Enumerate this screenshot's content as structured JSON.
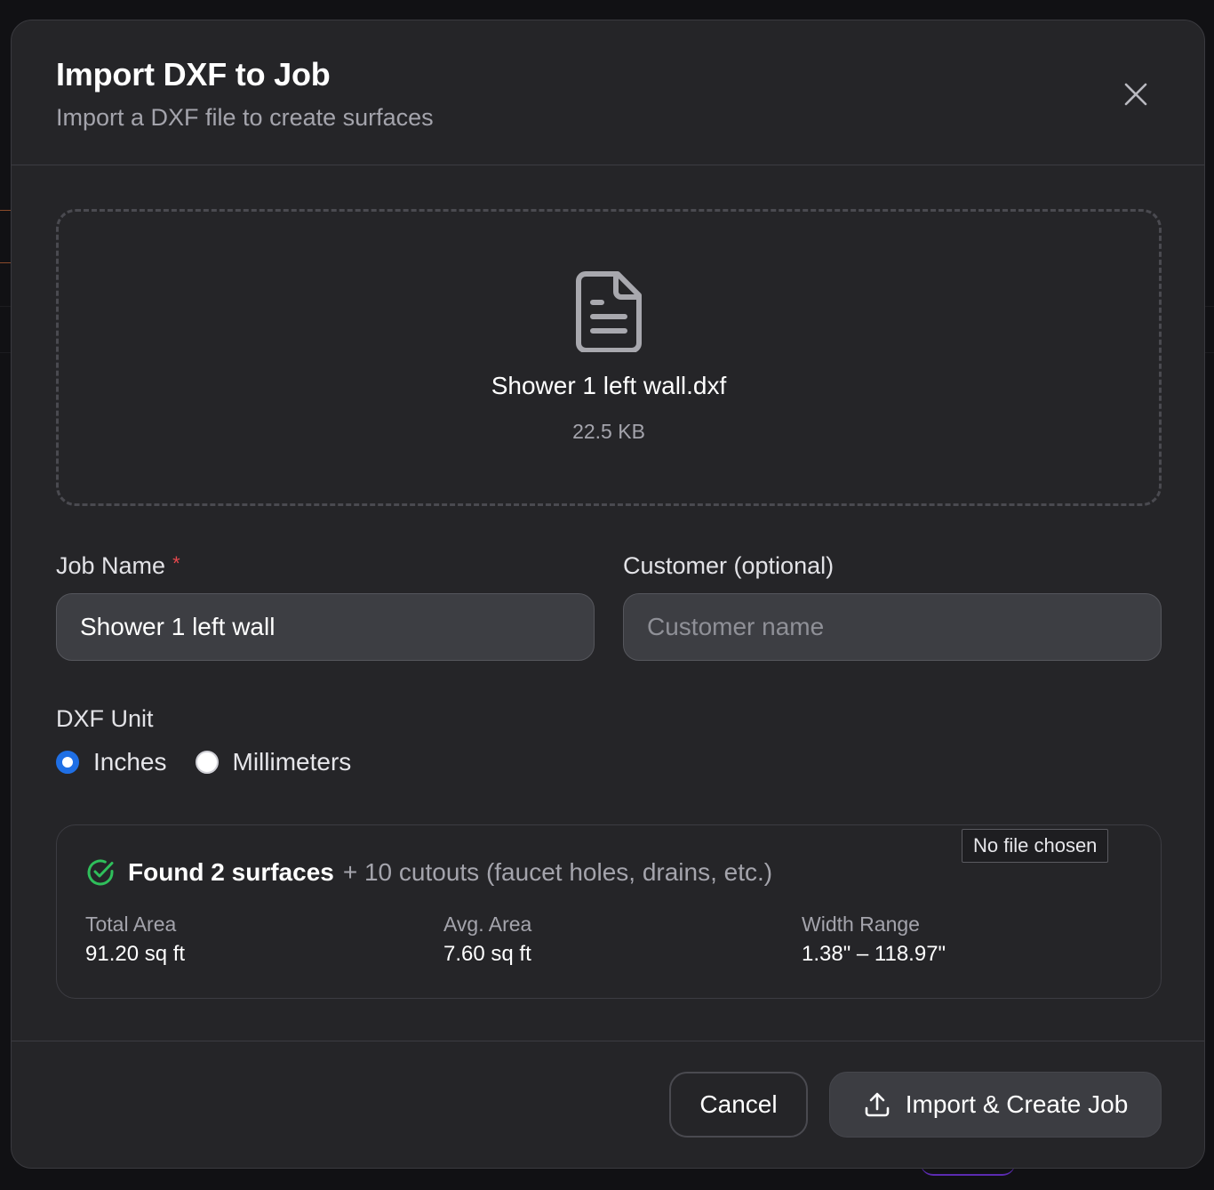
{
  "dialog": {
    "title": "Import DXF to Job",
    "subtitle": "Import a DXF file to create surfaces",
    "close_icon": "close-icon"
  },
  "dropzone": {
    "icon": "file-text-icon",
    "file_name": "Shower 1 left wall.dxf",
    "file_size": "22.5 KB"
  },
  "form": {
    "job_name_label": "Job Name",
    "job_name_required": "*",
    "job_name_value": "Shower 1 left wall",
    "customer_label": "Customer (optional)",
    "customer_placeholder": "Customer name",
    "customer_value": "",
    "unit_label": "DXF Unit",
    "unit_options": [
      {
        "label": "Inches",
        "checked": true
      },
      {
        "label": "Millimeters",
        "checked": false
      }
    ]
  },
  "summary": {
    "file_input_status": "No file chosen",
    "found_main": "Found 2 surfaces",
    "found_extra": "+ 10 cutouts (faucet holes, drains, etc.)",
    "stats": [
      {
        "label": "Total Area",
        "value": "91.20 sq ft"
      },
      {
        "label": "Avg. Area",
        "value": "7.60 sq ft"
      },
      {
        "label": "Width Range",
        "value": "1.38\" – 118.97\""
      }
    ],
    "check_icon": "check-circle-icon"
  },
  "footer": {
    "cancel_label": "Cancel",
    "import_label": "Import & Create Job",
    "import_icon": "upload-icon"
  },
  "colors": {
    "accent": "#1f6fe5",
    "success": "#2fbf5b",
    "required": "#e5484d"
  }
}
